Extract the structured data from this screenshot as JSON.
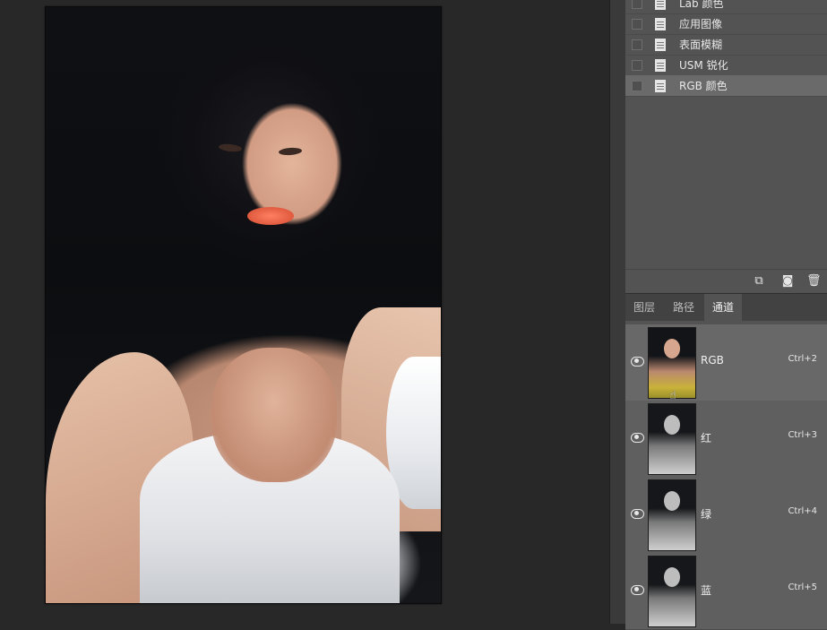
{
  "history": {
    "items": [
      {
        "label": "Lab 颜色",
        "selected": false
      },
      {
        "label": "应用图像",
        "selected": false
      },
      {
        "label": "表面模糊",
        "selected": false
      },
      {
        "label": "USM 锐化",
        "selected": false
      },
      {
        "label": "RGB 颜色",
        "selected": true
      }
    ],
    "footer_icons": [
      "new-document-from-state-icon",
      "camera-icon",
      "trash-icon"
    ]
  },
  "tabs": [
    {
      "label": "图层",
      "active": false
    },
    {
      "label": "路径",
      "active": false
    },
    {
      "label": "通道",
      "active": true
    }
  ],
  "channels": [
    {
      "name": "RGB",
      "shortcut": "Ctrl+2",
      "visible": true,
      "selected": true
    },
    {
      "name": "红",
      "shortcut": "Ctrl+3",
      "visible": true,
      "selected": false
    },
    {
      "name": "绿",
      "shortcut": "Ctrl+4",
      "visible": true,
      "selected": false
    },
    {
      "name": "蓝",
      "shortcut": "Ctrl+5",
      "visible": true,
      "selected": false
    }
  ],
  "colors": {
    "canvas_bg": "#282828",
    "panel_bg": "#535353",
    "selected_row": "#686868"
  }
}
